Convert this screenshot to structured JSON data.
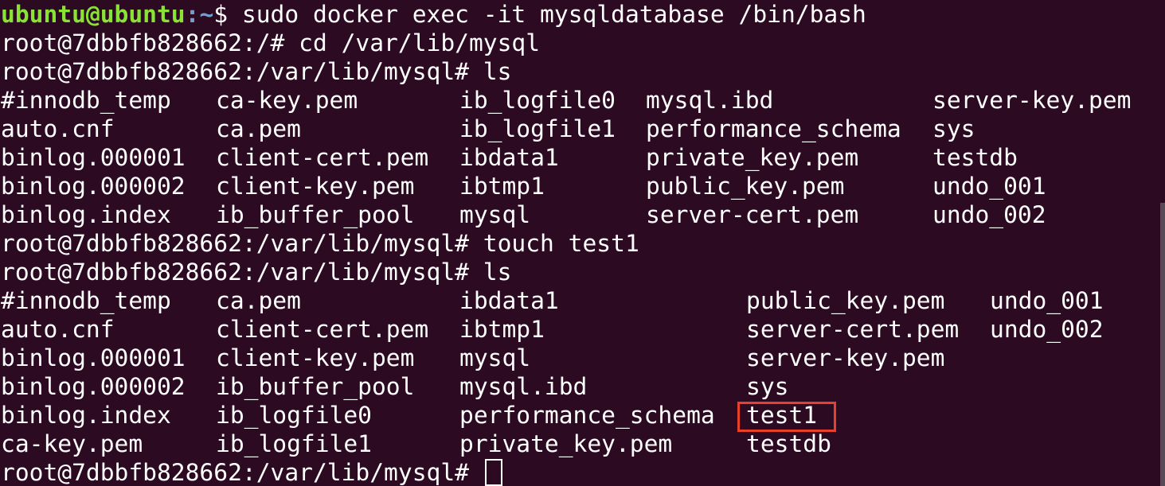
{
  "terminal": {
    "header": {
      "user_host": "ubuntu@ubuntu",
      "path_sep": ":~",
      "prompt_symbol": "$ ",
      "command": "sudo docker exec -it mysqldatabase /bin/bash"
    },
    "lines": [
      "root@7dbbfb828662:/# cd /var/lib/mysql",
      "root@7dbbfb828662:/var/lib/mysql# ls"
    ],
    "ls1": [
      [
        "#innodb_temp",
        "ca-key.pem",
        "ib_logfile0",
        "mysql.ibd",
        "server-key.pem"
      ],
      [
        "auto.cnf",
        "ca.pem",
        "ib_logfile1",
        "performance_schema",
        "sys"
      ],
      [
        "binlog.000001",
        "client-cert.pem",
        "ibdata1",
        "private_key.pem",
        "testdb"
      ],
      [
        "binlog.000002",
        "client-key.pem",
        "ibtmp1",
        "public_key.pem",
        "undo_001"
      ],
      [
        "binlog.index",
        "ib_buffer_pool",
        "mysql",
        "server-cert.pem",
        "undo_002"
      ]
    ],
    "touch_line": "root@7dbbfb828662:/var/lib/mysql# touch test1",
    "ls2_cmd": "root@7dbbfb828662:/var/lib/mysql# ls",
    "ls2": [
      [
        "#innodb_temp",
        "ca.pem",
        "ibdata1",
        "public_key.pem",
        "undo_001"
      ],
      [
        "auto.cnf",
        "client-cert.pem",
        "ibtmp1",
        "server-cert.pem",
        "undo_002"
      ],
      [
        "binlog.000001",
        "client-key.pem",
        "mysql",
        "server-key.pem",
        ""
      ],
      [
        "binlog.000002",
        "ib_buffer_pool",
        "mysql.ibd",
        "sys",
        ""
      ],
      [
        "binlog.index",
        "ib_logfile0",
        "performance_schema",
        "test1",
        ""
      ],
      [
        "ca-key.pem",
        "ib_logfile1",
        "private_key.pem",
        "testdb",
        ""
      ]
    ],
    "final_prompt": "root@7dbbfb828662:/var/lib/mysql# ",
    "colors": {
      "background": "#2c0a22",
      "text": "#ffffff",
      "user_host": "#8ae234",
      "highlight": "#e8402b"
    }
  }
}
